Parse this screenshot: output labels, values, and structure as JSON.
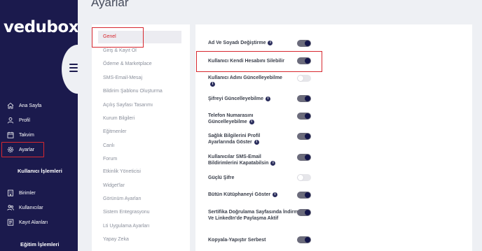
{
  "app": {
    "logo": "vedubox"
  },
  "page": {
    "title": "Ayarlar"
  },
  "sidebar": {
    "items": [
      {
        "label": "Ana Sayfa",
        "icon": "home-icon"
      },
      {
        "label": "Profil",
        "icon": "user-icon"
      },
      {
        "label": "Takvim",
        "icon": "calendar-icon"
      },
      {
        "label": "Ayarlar",
        "icon": "gear-icon",
        "active": true
      }
    ],
    "section1": {
      "title": "Kullanıcı İşlemleri"
    },
    "section1_items": [
      {
        "label": "Birimler",
        "icon": "building-icon"
      },
      {
        "label": "Kullanıcılar",
        "icon": "users-icon"
      },
      {
        "label": "Kayıt Alanları",
        "icon": "form-icon"
      }
    ],
    "section2": {
      "title": "Eğitim İşlemleri"
    }
  },
  "menu": {
    "items": [
      {
        "label": "Genel",
        "selected": true
      },
      {
        "label": "Giriş & Kayıt Ol"
      },
      {
        "label": "Ödeme & Marketplace"
      },
      {
        "label": "SMS-Email-Mesaj"
      },
      {
        "label": "Bildirim Şablonu Oluşturma"
      },
      {
        "label": "Açılış Sayfası Tasarımı"
      },
      {
        "label": "Kurum Bilgileri"
      },
      {
        "label": "Eğitmenler"
      },
      {
        "label": "Canlı"
      },
      {
        "label": "Forum"
      },
      {
        "label": "Etkinlik Yöneticisi"
      },
      {
        "label": "Widget'lar"
      },
      {
        "label": "Görünüm Ayarları"
      },
      {
        "label": "Sistem Entegrasyonu"
      },
      {
        "label": "Lti Uygulama Ayarları"
      },
      {
        "label": "Yapay Zeka"
      }
    ]
  },
  "settings": {
    "rows": [
      {
        "label": "Ad Ve Soyadı Değiştirme",
        "info": true,
        "enabled": true
      },
      {
        "label": "Kullanıcı Kendi Hesabını Silebilir",
        "info": false,
        "enabled": true
      },
      {
        "label": "Kullanıcı Adını Güncelleyebilme",
        "info": true,
        "enabled": false
      },
      {
        "label": "Şifreyi Güncelleyebilme",
        "info": true,
        "enabled": true
      },
      {
        "label": "Telefon Numarasını Güncelleyebilme",
        "info": true,
        "enabled": true
      },
      {
        "label": "Sağlık Bilgilerini Profil Ayarlarında Göster",
        "info": true,
        "enabled": true
      },
      {
        "label": "Kullanıcılar SMS-Email Bildirimlerini Kapatabilsin",
        "info": true,
        "enabled": true
      },
      {
        "label": "Güçlü Şifre",
        "info": false,
        "enabled": false
      },
      {
        "label": "Bütün Kütüphaneyi Göster",
        "info": true,
        "enabled": true
      },
      {
        "label": "Sertifika Doğrulama Sayfasında İndirme Ve LinkedIn'de Paylaşma Aktif",
        "info": false,
        "enabled": true
      },
      {
        "label": "Kopyala-Yapıştır Serbest",
        "info": false,
        "enabled": true
      }
    ]
  },
  "colors": {
    "sidebar": "#1b1a4d",
    "highlight": "#d7282f",
    "toggle_on": "#6b6b7b",
    "knob_on": "#14164a"
  }
}
